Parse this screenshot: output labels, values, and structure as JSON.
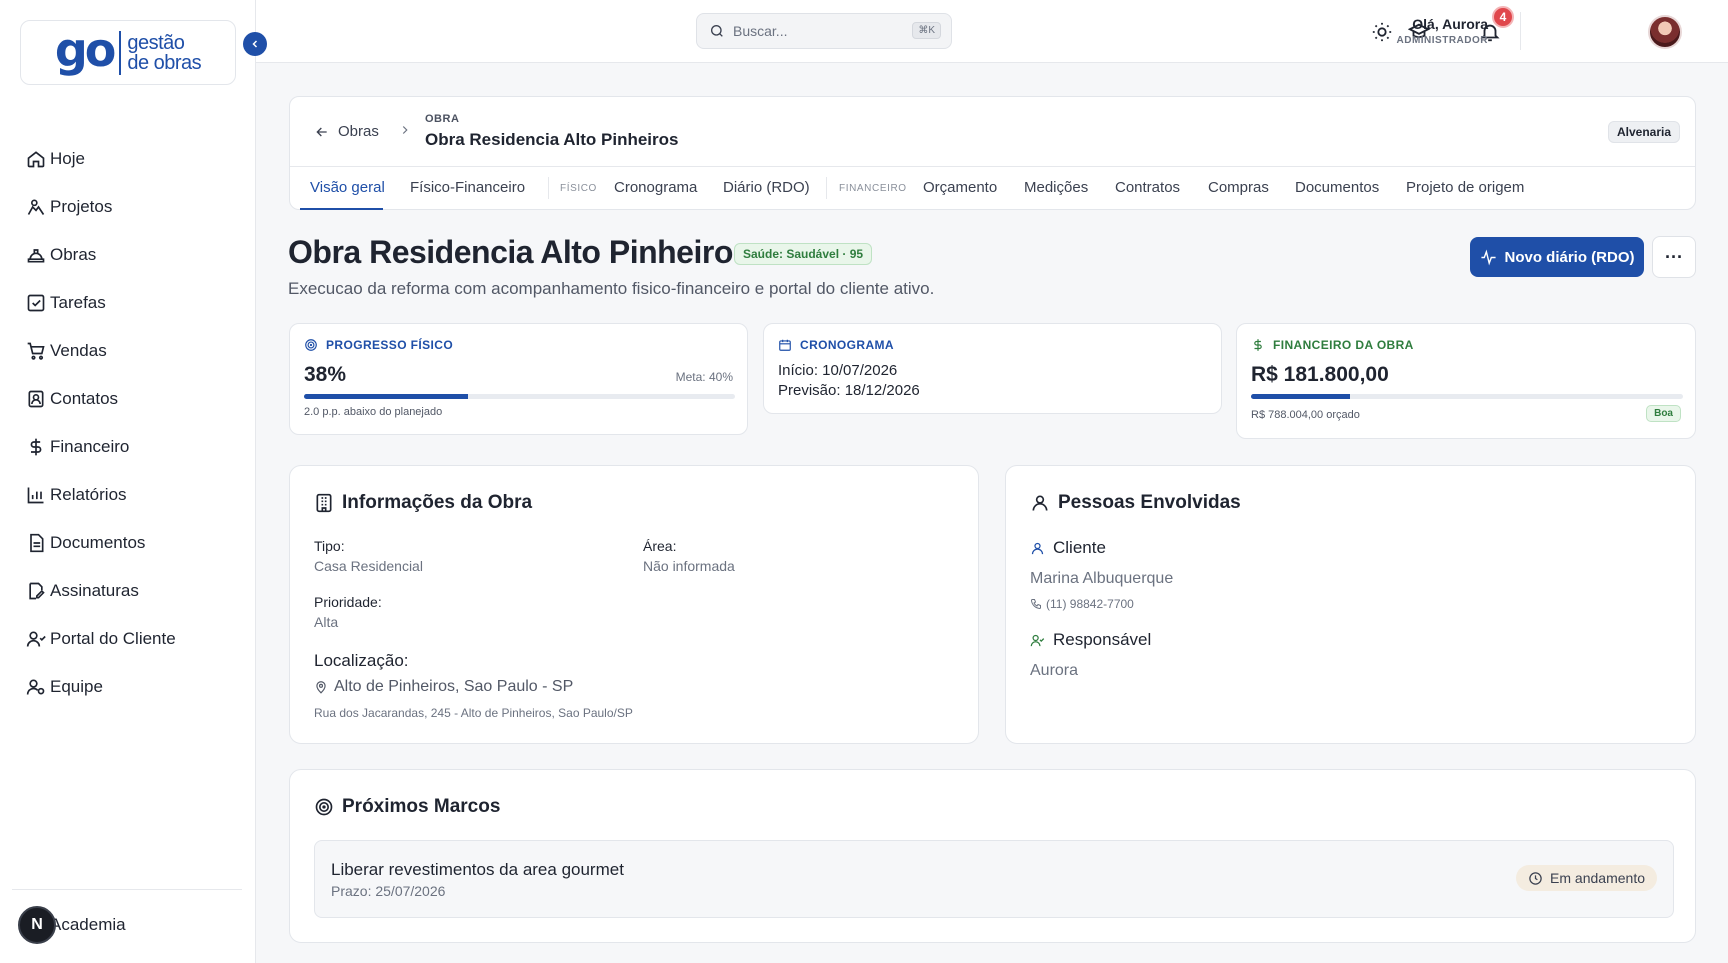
{
  "brand": {
    "logo_mark": "go",
    "logo_line1": "gestão",
    "logo_line2": "de obras"
  },
  "sidebar": {
    "collapse_icon": "chevron-left-icon",
    "items": [
      {
        "label": "Hoje",
        "icon": "home-icon"
      },
      {
        "label": "Projetos",
        "icon": "projects-icon"
      },
      {
        "label": "Obras",
        "icon": "hardhat-icon"
      },
      {
        "label": "Tarefas",
        "icon": "checkbox-icon"
      },
      {
        "label": "Vendas",
        "icon": "cart-icon"
      },
      {
        "label": "Contatos",
        "icon": "contacts-icon"
      },
      {
        "label": "Financeiro",
        "icon": "dollar-icon"
      },
      {
        "label": "Relatórios",
        "icon": "chart-icon"
      },
      {
        "label": "Documentos",
        "icon": "document-icon"
      },
      {
        "label": "Assinaturas",
        "icon": "signature-icon"
      },
      {
        "label": "Portal do Cliente",
        "icon": "client-portal-icon"
      },
      {
        "label": "Equipe",
        "icon": "team-icon"
      }
    ],
    "academia_label": "Academia",
    "fab_letter": "N"
  },
  "topbar": {
    "search_placeholder": "Buscar...",
    "search_shortcut": "⌘K",
    "notification_count": "4",
    "greeting": "Olá, Aurora",
    "role": "ADMINISTRADOR"
  },
  "header": {
    "back_label": "Obras",
    "crumb_label": "OBRA",
    "crumb_title": "Obra Residencia Alto Pinheiros",
    "category_chip": "Alvenaria",
    "tabs": [
      {
        "label": "Visão geral"
      },
      {
        "label": "Físico-Financeiro"
      },
      {
        "label": "Cronograma"
      },
      {
        "label": "Diário (RDO)"
      },
      {
        "label": "Orçamento"
      },
      {
        "label": "Medições"
      },
      {
        "label": "Contratos"
      },
      {
        "label": "Compras"
      },
      {
        "label": "Documentos"
      },
      {
        "label": "Projeto de origem"
      }
    ],
    "group_fisico": "FÍSICO",
    "group_financeiro": "FINANCEIRO"
  },
  "page": {
    "title": "Obra Residencia Alto Pinheiros",
    "health_badge": "Saúde: Saudável · 95",
    "subtitle": "Execucao da reforma com acompanhamento fisico-financeiro e portal do cliente ativo.",
    "primary_button": "Novo diário (RDO)",
    "more_button": "···"
  },
  "stats": {
    "progress": {
      "label": "PROGRESSO FÍSICO",
      "value": "38%",
      "percent": 38,
      "meta": "Meta: 40%",
      "note": "2.0 p.p. abaixo do planejado",
      "color": "#1f4fa8"
    },
    "schedule": {
      "label": "CRONOGRAMA",
      "start": "Início: 10/07/2026",
      "forecast": "Previsão: 18/12/2026",
      "color": "#1f4fa8"
    },
    "finance": {
      "label": "FINANCEIRO DA OBRA",
      "value": "R$ 181.800,00",
      "percent": 23,
      "budget": "R$ 788.004,00 orçado",
      "status": "Boa",
      "color": "#2f7d3e"
    }
  },
  "info": {
    "title": "Informações da Obra",
    "tipo_label": "Tipo:",
    "tipo_value": "Casa Residencial",
    "area_label": "Área:",
    "area_value": "Não informada",
    "prioridade_label": "Prioridade:",
    "prioridade_value": "Alta",
    "localizacao_label": "Localização:",
    "localizacao_value": "Alto de Pinheiros, Sao Paulo - SP",
    "endereco": "Rua dos Jacarandas, 245 - Alto de Pinheiros, Sao Paulo/SP"
  },
  "people": {
    "title": "Pessoas Envolvidas",
    "client_label": "Cliente",
    "client_name": "Marina Albuquerque",
    "client_phone": "(11) 98842-7700",
    "responsible_label": "Responsável",
    "responsible_name": "Aurora"
  },
  "milestones": {
    "title": "Próximos Marcos",
    "items": [
      {
        "title": "Liberar revestimentos da area gourmet",
        "due": "Prazo: 25/07/2026",
        "status": "Em andamento"
      }
    ]
  }
}
